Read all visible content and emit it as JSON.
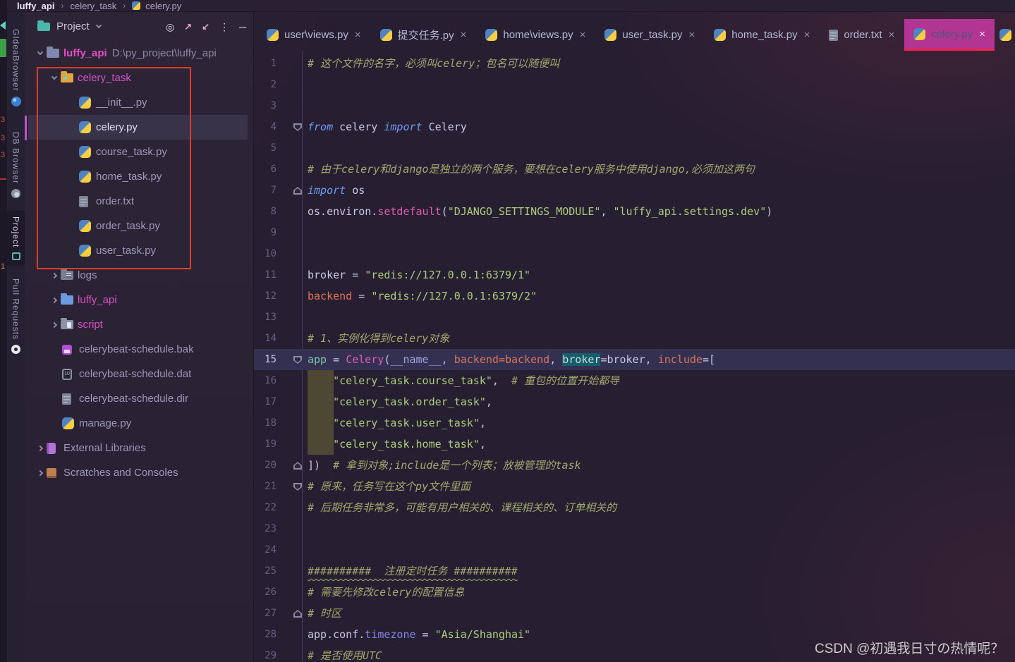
{
  "nav": {
    "crumbs": [
      {
        "label": "luffy_api",
        "bold": true
      },
      {
        "label": "celery_task"
      },
      {
        "label": "celery.py",
        "icon": "python"
      }
    ]
  },
  "edge_fragments": [
    "3",
    "3",
    "3",
    "1"
  ],
  "toolstrip": {
    "tools": [
      {
        "label": "GIdeaBrowser",
        "icon": "globe-icon",
        "active": false
      },
      {
        "label": "DB Browser",
        "icon": "database-icon",
        "active": false
      },
      {
        "label": "Project",
        "icon": "project-tool-icon",
        "active": true
      },
      {
        "label": "Pull Requests",
        "icon": "github-icon",
        "active": false
      }
    ]
  },
  "project": {
    "title": "Project",
    "tree": [
      {
        "label": "luffy_api",
        "path": "D:\\py_project\\luffy_api",
        "depth": 0,
        "icon": "folder-blue",
        "chevron": "open",
        "accent": true,
        "bold": true
      },
      {
        "label": "celery_task",
        "depth": 1,
        "icon": "folder-package",
        "chevron": "open",
        "accent": true
      },
      {
        "label": "__init__.py",
        "depth": 2,
        "icon": "python"
      },
      {
        "label": "celery.py",
        "depth": 2,
        "icon": "python",
        "selected": true
      },
      {
        "label": "course_task.py",
        "depth": 2,
        "icon": "python"
      },
      {
        "label": "home_task.py",
        "depth": 2,
        "icon": "python"
      },
      {
        "label": "order.txt",
        "depth": 2,
        "icon": "text"
      },
      {
        "label": "order_task.py",
        "depth": 2,
        "icon": "python"
      },
      {
        "label": "user_task.py",
        "depth": 2,
        "icon": "python"
      },
      {
        "label": "logs",
        "depth": 1,
        "icon": "folder-logs",
        "chevron": "closed"
      },
      {
        "label": "luffy_api",
        "depth": 1,
        "icon": "folder-blue2",
        "chevron": "closed",
        "accent": true
      },
      {
        "label": "script",
        "depth": 1,
        "icon": "folder-script",
        "chevron": "closed",
        "accent": true
      },
      {
        "label": "celerybeat-schedule.bak",
        "depth": 1,
        "icon": "file-bak"
      },
      {
        "label": "celerybeat-schedule.dat",
        "depth": 1,
        "icon": "file-dat"
      },
      {
        "label": "celerybeat-schedule.dir",
        "depth": 1,
        "icon": "text"
      },
      {
        "label": "manage.py",
        "depth": 1,
        "icon": "python"
      },
      {
        "label": "External Libraries",
        "depth": 0,
        "icon": "libraries",
        "chevron": "closed"
      },
      {
        "label": "Scratches and Consoles",
        "depth": 0,
        "icon": "scratches",
        "chevron": "closed"
      }
    ]
  },
  "tabs": [
    {
      "label": "user\\views.py",
      "icon": "python"
    },
    {
      "label": "提交任务.py",
      "icon": "python"
    },
    {
      "label": "home\\views.py",
      "icon": "python"
    },
    {
      "label": "user_task.py",
      "icon": "python"
    },
    {
      "label": "home_task.py",
      "icon": "python"
    },
    {
      "label": "order.txt",
      "icon": "text"
    },
    {
      "label": "celery.py",
      "icon": "python",
      "active": true
    },
    {
      "label": "",
      "icon": "python",
      "partial": true
    }
  ],
  "editor": {
    "lines": [
      {
        "n": 1,
        "t": [
          [
            "# 这个文件的名字，必须叫celery；包名可以随便叫",
            "c"
          ]
        ]
      },
      {
        "n": 2,
        "t": []
      },
      {
        "n": 3,
        "t": []
      },
      {
        "n": 4,
        "fold": "down",
        "t": [
          [
            "from",
            "k"
          ],
          [
            " celery ",
            "p"
          ],
          [
            "import",
            "k"
          ],
          [
            " Celery",
            "p"
          ]
        ]
      },
      {
        "n": 5,
        "t": []
      },
      {
        "n": 6,
        "t": [
          [
            "# 由于celery和django是独立的两个服务，要想在celery服务中使用django,必须加这两句",
            "c"
          ]
        ]
      },
      {
        "n": 7,
        "fold": "up",
        "t": [
          [
            "import",
            "k"
          ],
          [
            " os",
            "p"
          ]
        ]
      },
      {
        "n": 8,
        "t": [
          [
            "os.environ.",
            "p"
          ],
          [
            "setdefault",
            "f"
          ],
          [
            "(",
            "p"
          ],
          [
            "\"DJANGO_SETTINGS_MODULE\"",
            "s"
          ],
          [
            ", ",
            "p"
          ],
          [
            "\"luffy_api.settings.dev\"",
            "s"
          ],
          [
            ")",
            "p"
          ]
        ]
      },
      {
        "n": 9,
        "t": []
      },
      {
        "n": 10,
        "t": []
      },
      {
        "n": 11,
        "t": [
          [
            "broker = ",
            "p"
          ],
          [
            "\"redis://127.0.0.1:6379/1\"",
            "s"
          ]
        ]
      },
      {
        "n": 12,
        "t": [
          [
            "backend",
            "o"
          ],
          [
            " = ",
            "p"
          ],
          [
            "\"redis://127.0.0.1:6379/2\"",
            "s"
          ]
        ]
      },
      {
        "n": 13,
        "t": []
      },
      {
        "n": 14,
        "t": [
          [
            "# 1、实例化得到celery对象",
            "c"
          ]
        ]
      },
      {
        "n": 15,
        "cur": true,
        "fold": "down",
        "t": [
          [
            "app",
            "g"
          ],
          [
            " = ",
            "p"
          ],
          [
            "Celery",
            "f"
          ],
          [
            "(",
            "p"
          ],
          [
            "__name__",
            "d"
          ],
          [
            ", ",
            "p"
          ],
          [
            "backend=backend",
            "o"
          ],
          [
            ", ",
            "p"
          ],
          [
            "broker",
            "h"
          ],
          [
            "=broker, ",
            "p"
          ],
          [
            "include",
            "o"
          ],
          [
            "=[",
            "p"
          ]
        ]
      },
      {
        "n": 16,
        "t": [
          [
            "    ",
            "p"
          ],
          [
            "\"celery_task.course_task\"",
            "s"
          ],
          [
            ",  ",
            "p"
          ],
          [
            "# 重包的位置开始都导",
            "c"
          ]
        ]
      },
      {
        "n": 17,
        "t": [
          [
            "    ",
            "p"
          ],
          [
            "\"celery_task.order_task\"",
            "s"
          ],
          [
            ",",
            "p"
          ]
        ]
      },
      {
        "n": 18,
        "t": [
          [
            "    ",
            "p"
          ],
          [
            "\"celery_task.user_task\"",
            "s"
          ],
          [
            ",",
            "p"
          ]
        ]
      },
      {
        "n": 19,
        "t": [
          [
            "    ",
            "p"
          ],
          [
            "\"celery_task.home_task\"",
            "s"
          ],
          [
            ",",
            "p"
          ]
        ]
      },
      {
        "n": 20,
        "fold": "up",
        "t": [
          [
            "])  ",
            "p"
          ],
          [
            "# 拿到对象;include是一个列表；放被管理的task",
            "c"
          ]
        ]
      },
      {
        "n": 21,
        "fold": "down",
        "t": [
          [
            "# 原来，任务写在这个py文件里面",
            "c"
          ]
        ]
      },
      {
        "n": 22,
        "t": [
          [
            "# 后期任务非常多，可能有用户相关的、课程相关的、订单相关的",
            "c"
          ]
        ]
      },
      {
        "n": 23,
        "t": []
      },
      {
        "n": 24,
        "t": []
      },
      {
        "n": 25,
        "t": [
          [
            "##########  注册定时任务 ##########",
            "c w"
          ]
        ]
      },
      {
        "n": 26,
        "t": [
          [
            "# 需要先修改celery的配置信息",
            "c"
          ]
        ]
      },
      {
        "n": 27,
        "fold": "up",
        "t": [
          [
            "# 时区",
            "c"
          ]
        ]
      },
      {
        "n": 28,
        "t": [
          [
            "app.conf.",
            "p"
          ],
          [
            "timezone",
            "a"
          ],
          [
            " = ",
            "p"
          ],
          [
            "\"Asia/Shanghai\"",
            "s"
          ]
        ]
      },
      {
        "n": 29,
        "t": [
          [
            "# 是否使用UTC",
            "c"
          ]
        ]
      }
    ]
  },
  "watermark": {
    "text": "CSDN @初遇我日寸の热情呢？"
  },
  "colors": {
    "active_tab": "#b23594",
    "tab_underline": "#f2224a",
    "annotation_red": "#e03a28",
    "accent_magenta": "#c44fd0",
    "string": "#accc7a",
    "comment": "#a0aa6d",
    "keyword": "#6b9bf2",
    "function_call": "#e35cb2"
  }
}
